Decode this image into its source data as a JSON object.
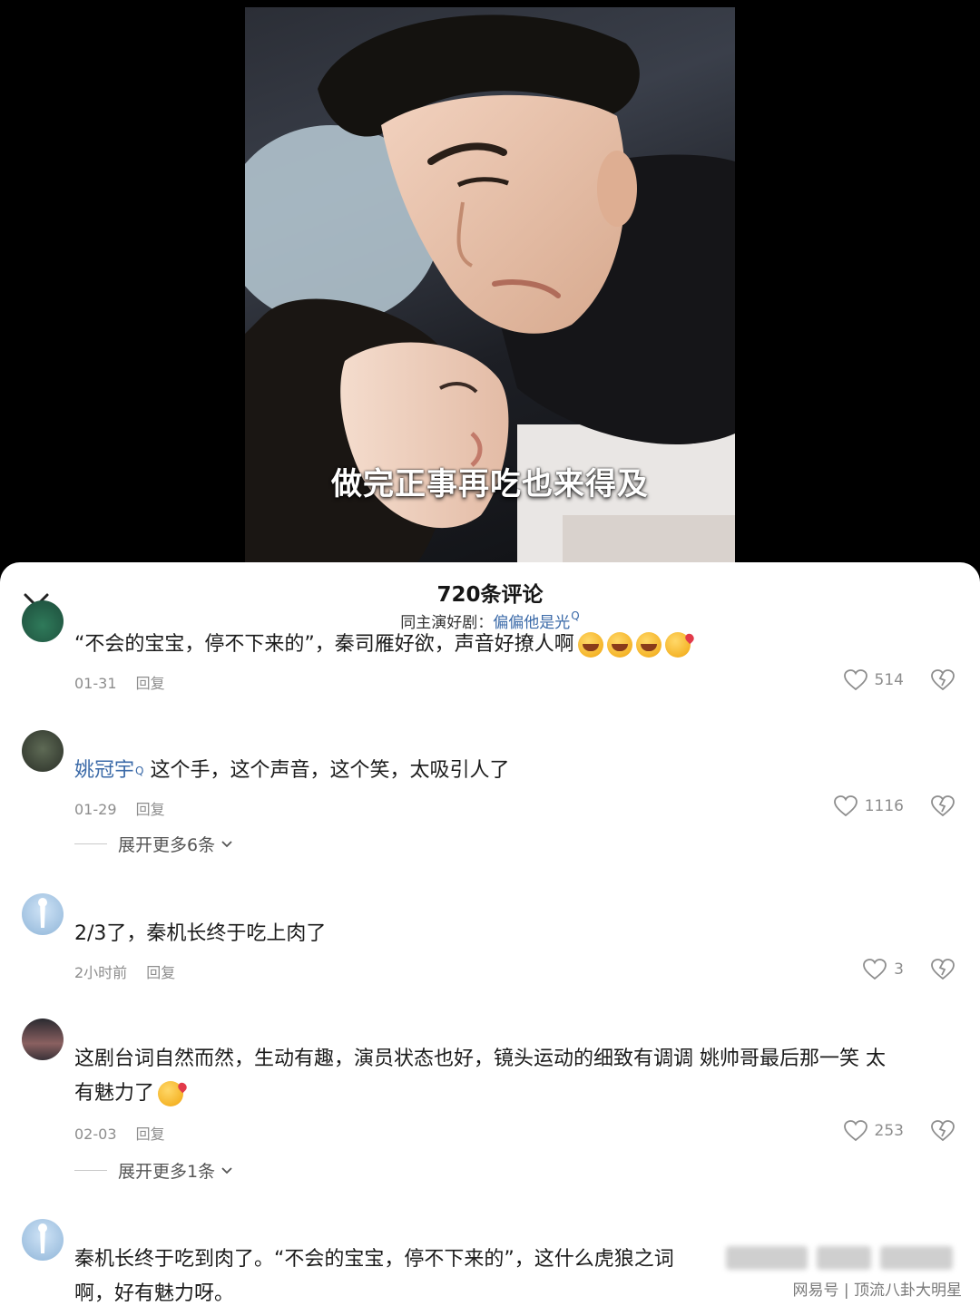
{
  "video": {
    "subtitle": "做完正事再吃也来得及"
  },
  "sheet": {
    "title": "720条评论",
    "subtitle_prefix": "同主演好剧：",
    "subtitle_link": "偏偏他是光",
    "search_mark": "Q"
  },
  "comments": [
    {
      "name": "",
      "text": "“不会的宝宝，停不下来的”，秦司雁好欲，声音好撩人啊",
      "emojis": [
        "cry-laugh",
        "cry-laugh",
        "cry-laugh",
        "kiss"
      ],
      "date": "01-31",
      "reply": "回复",
      "likes": "514"
    },
    {
      "name": "姚冠宇",
      "text": "这个手，这个声音，这个笑，太吸引人了",
      "date": "01-29",
      "reply": "回复",
      "likes": "1116",
      "expand": "展开更多6条"
    },
    {
      "name": "",
      "text": "2/3了，秦机长终于吃上肉了",
      "date": "2小时前",
      "reply": "回复",
      "likes": "3"
    },
    {
      "name": "",
      "text_line1": "这剧台词自然而然，生动有趣，演员状态也好，镜头运动的细致有调调   姚帅哥最后那一笑  太",
      "text_line2": "有魅力了",
      "emojis": [
        "kiss"
      ],
      "date": "02-03",
      "reply": "回复",
      "likes": "253",
      "expand": "展开更多1条"
    },
    {
      "name": "",
      "text_line1": "秦机长终于吃到肉了。“不会的宝宝，停不下来的”，这什么虎狼之词",
      "text_line2": "啊，好有魅力呀。"
    }
  ],
  "watermark": "网易号 | 顶流八卦大明星",
  "colors": {
    "link": "#3b6aa8",
    "meta": "#8d8d8d",
    "sheet_bg": "#ffffff",
    "page_bg": "#000000"
  },
  "icons": [
    "chevron-down-icon",
    "heart-icon",
    "broken-heart-icon",
    "search-icon"
  ]
}
